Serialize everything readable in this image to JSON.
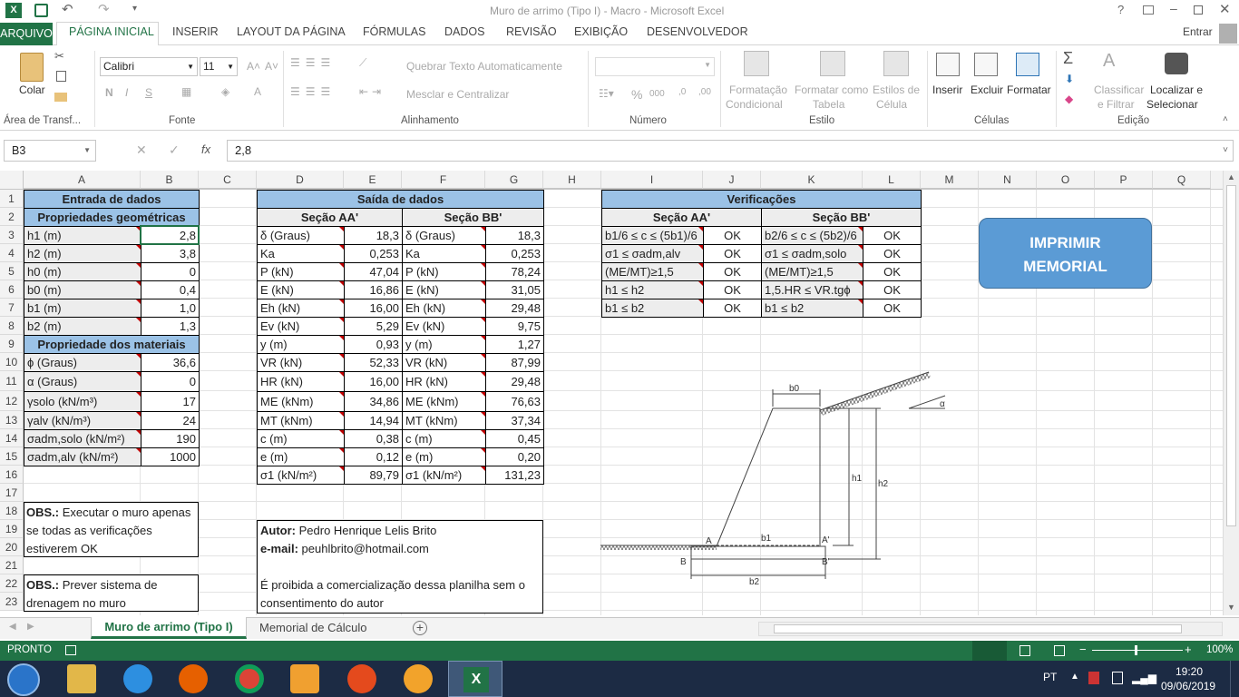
{
  "window": {
    "title": "Muro de arrimo (Tipo I) - Macro - Microsoft Excel",
    "help": "?",
    "signin": "Entrar"
  },
  "tabs": [
    "ARQUIVO",
    "PÁGINA INICIAL",
    "INSERIR",
    "LAYOUT DA PÁGINA",
    "FÓRMULAS",
    "DADOS",
    "REVISÃO",
    "EXIBIÇÃO",
    "DESENVOLVEDOR"
  ],
  "ribbon": {
    "clipboard": {
      "paste": "Colar",
      "label": "Área de Transf..."
    },
    "font": {
      "name": "Calibri",
      "size": "11",
      "bold": "N",
      "italic": "I",
      "underline": "S",
      "label": "Fonte"
    },
    "alignment": {
      "wrap": "Quebrar Texto Automaticamente",
      "merge": "Mesclar e Centralizar",
      "label": "Alinhamento"
    },
    "number": {
      "percent": "%",
      "thousands": "000",
      "label": "Número"
    },
    "styles": {
      "cond1": "Formatação",
      "cond2": "Condicional",
      "table1": "Formatar como",
      "table2": "Tabela",
      "cell1": "Estilos de",
      "cell2": "Célula",
      "label": "Estilo"
    },
    "cells": {
      "insert": "Inserir",
      "delete": "Excluir",
      "format": "Formatar",
      "label": "Células"
    },
    "editing": {
      "sort1": "Classificar",
      "sort2": "e Filtrar",
      "find1": "Localizar e",
      "find2": "Selecionar",
      "label": "Edição"
    }
  },
  "formula": {
    "namebox": "B3",
    "fx": "fx",
    "value": "2,8"
  },
  "columns": [
    "A",
    "B",
    "C",
    "D",
    "E",
    "F",
    "G",
    "H",
    "I",
    "J",
    "K",
    "L",
    "M",
    "N",
    "O",
    "P",
    "Q"
  ],
  "rows": [
    "1",
    "2",
    "3",
    "4",
    "5",
    "6",
    "7",
    "8",
    "9",
    "10",
    "11",
    "12",
    "13",
    "14",
    "15",
    "16",
    "17",
    "18",
    "19",
    "20",
    "21",
    "22",
    "23"
  ],
  "entrada": {
    "title": "Entrada de dados",
    "geo_header": "Propriedades geométricas",
    "geo": [
      [
        "h1 (m)",
        "2,8"
      ],
      [
        "h2 (m)",
        "3,8"
      ],
      [
        "h0 (m)",
        "0"
      ],
      [
        "b0 (m)",
        "0,4"
      ],
      [
        "b1 (m)",
        "1,0"
      ],
      [
        "b2 (m)",
        "1,3"
      ]
    ],
    "mat_header": "Propriedade dos materiais",
    "mat": [
      [
        "ϕ (Graus)",
        "36,6"
      ],
      [
        "α (Graus)",
        "0"
      ],
      [
        "γsolo (kN/m³)",
        "17"
      ],
      [
        "γalv (kN/m³)",
        "24"
      ],
      [
        "σadm,solo (kN/m²)",
        "190"
      ],
      [
        "σadm,alv (kN/m²)",
        "1000"
      ]
    ]
  },
  "saida": {
    "title": "Saída de dados",
    "aa": "Seção AA'",
    "bb": "Seção BB'",
    "rows": [
      [
        "δ (Graus)",
        "18,3",
        "δ (Graus)",
        "18,3"
      ],
      [
        "Ka",
        "0,253",
        "Ka",
        "0,253"
      ],
      [
        "P (kN)",
        "47,04",
        "P (kN)",
        "78,24"
      ],
      [
        "E (kN)",
        "16,86",
        "E (kN)",
        "31,05"
      ],
      [
        "Eh (kN)",
        "16,00",
        "Eh (kN)",
        "29,48"
      ],
      [
        "Ev (kN)",
        "5,29",
        "Ev (kN)",
        "9,75"
      ],
      [
        "y (m)",
        "0,93",
        "y (m)",
        "1,27"
      ],
      [
        "VR (kN)",
        "52,33",
        "VR (kN)",
        "87,99"
      ],
      [
        "HR (kN)",
        "16,00",
        "HR (kN)",
        "29,48"
      ],
      [
        "ME (kNm)",
        "34,86",
        "ME (kNm)",
        "76,63"
      ],
      [
        "MT (kNm)",
        "14,94",
        "MT (kNm)",
        "37,34"
      ],
      [
        "c (m)",
        "0,38",
        "c (m)",
        "0,45"
      ],
      [
        "e (m)",
        "0,12",
        "e (m)",
        "0,20"
      ],
      [
        "σ1 (kN/m²)",
        "89,79",
        "σ1 (kN/m²)",
        "131,23"
      ]
    ]
  },
  "verif": {
    "title": "Verificações",
    "aa": "Seção AA'",
    "bb": "Seção BB'",
    "rows": [
      [
        "b1/6 ≤ c ≤ (5b1)/6",
        "OK",
        "b2/6 ≤ c ≤ (5b2)/6",
        "OK"
      ],
      [
        "σ1 ≤ σadm,alv",
        "OK",
        "σ1 ≤ σadm,solo",
        "OK"
      ],
      [
        "(ME/MT)≥1,5",
        "OK",
        "(ME/MT)≥1,5",
        "OK"
      ],
      [
        "h1 ≤ h2",
        "OK",
        "1,5.HR ≤ VR.tgϕ",
        "OK"
      ],
      [
        "b1 ≤ b2",
        "OK",
        "b1 ≤ b2",
        "OK"
      ]
    ]
  },
  "print_button": {
    "line1": "IMPRIMIR",
    "line2": "MEMORIAL"
  },
  "obs1": {
    "bold": "OBS.:",
    "l1": " Executar o muro apenas",
    "l2": "se todas as verificações",
    "l3": "estiverem OK"
  },
  "obs2": {
    "bold": "OBS.:",
    "l1": " Prever sistema de",
    "l2": "drenagem no muro"
  },
  "autor": {
    "label1": "Autor:",
    "name": " Pedro Henrique Lelis Brito",
    "label2": "e-mail:",
    "email": " peuhlbrito@hotmail.com",
    "n1": "É proibida a comercialização dessa planilha sem o",
    "n2": "consentimento do autor"
  },
  "diagram": {
    "b0": "b0",
    "b1": "b1",
    "b2": "b2",
    "h1": "h1",
    "h2": "h2",
    "A": "A",
    "A2": "A'",
    "B": "B",
    "B2": "B'",
    "alpha": "α"
  },
  "sheets": [
    "Muro de arrimo (Tipo I)",
    "Memorial de Cálculo"
  ],
  "status": {
    "mode": "PRONTO",
    "zoom": "100%"
  },
  "tray": {
    "lang": "PT",
    "time": "19:20",
    "date": "09/06/2019"
  },
  "colors": {
    "excel_green": "#217346",
    "header_blue": "#9bc2e6",
    "button_blue": "#5b9bd5"
  }
}
